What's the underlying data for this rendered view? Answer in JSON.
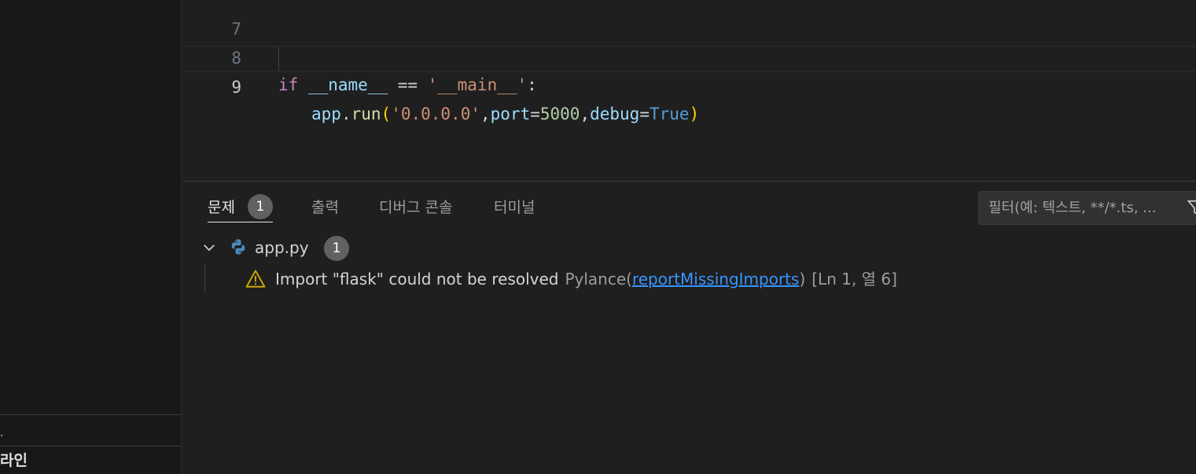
{
  "sidebar": {
    "dot_text": ".",
    "section_title": "라인"
  },
  "editor": {
    "lines": [
      {
        "number": "7"
      },
      {
        "number": "8"
      },
      {
        "number": "9"
      }
    ],
    "line8": {
      "kw_if": "if",
      "name": "__name__",
      "eq": "==",
      "main_str": "'__main__'",
      "colon": ":"
    },
    "line9": {
      "app": "app",
      "dot": ".",
      "run": "run",
      "lparen": "(",
      "host_str": "'0.0.0.0'",
      "comma1": ",",
      "port_kw": "port",
      "eq1": "=",
      "port_val": "5000",
      "comma2": ",",
      "debug_kw": "debug",
      "eq2": "=",
      "debug_val": "True",
      "rparen": ")"
    }
  },
  "panel": {
    "tabs": [
      {
        "label": "문제",
        "badge": "1"
      },
      {
        "label": "출력"
      },
      {
        "label": "디버그 콘솔"
      },
      {
        "label": "터미널"
      }
    ],
    "filter": {
      "placeholder": "필터(예: 텍스트, **/*.ts, ..."
    },
    "file": {
      "name": "app.py",
      "count": "1"
    },
    "problem": {
      "message": "Import \"flask\" could not be resolved",
      "source": "Pylance",
      "code_open": "(",
      "code": "reportMissingImports",
      "code_close": ")",
      "position": "[Ln 1, 열 6]"
    }
  },
  "colors": {
    "background": "#1f1f1f",
    "sidebar": "#181818",
    "warning": "#cca700",
    "link": "#3794ff",
    "badge": "#616161"
  }
}
